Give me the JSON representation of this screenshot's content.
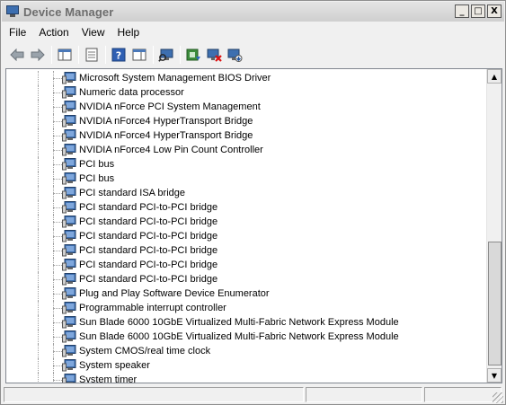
{
  "window": {
    "title": "Device Manager",
    "caption": {
      "minimize": "_",
      "maximize": "□",
      "close": "X"
    }
  },
  "menu": [
    "File",
    "Action",
    "View",
    "Help"
  ],
  "toolbar": {
    "buttons": [
      "back-arrow-icon",
      "forward-arrow-icon",
      "show-hide-console-tree-icon",
      "properties-icon",
      "help-icon",
      "action-pane-icon",
      "scan-hardware-icon",
      "update-driver-icon",
      "uninstall-icon",
      "disable-device-icon"
    ]
  },
  "tree": {
    "items": [
      "Microsoft System Management BIOS Driver",
      "Numeric data processor",
      "NVIDIA nForce PCI System Management",
      "NVIDIA nForce4 HyperTransport Bridge",
      "NVIDIA nForce4 HyperTransport Bridge",
      "NVIDIA nForce4 Low Pin Count Controller",
      "PCI bus",
      "PCI bus",
      "PCI standard ISA bridge",
      "PCI standard PCI-to-PCI bridge",
      "PCI standard PCI-to-PCI bridge",
      "PCI standard PCI-to-PCI bridge",
      "PCI standard PCI-to-PCI bridge",
      "PCI standard PCI-to-PCI bridge",
      "PCI standard PCI-to-PCI bridge",
      "Plug and Play Software Device Enumerator",
      "Programmable interrupt controller",
      "Sun Blade 6000 10GbE Virtualized Multi-Fabric Network Express Module",
      "Sun Blade 6000 10GbE Virtualized Multi-Fabric Network Express Module",
      "System CMOS/real time clock",
      "System speaker",
      "System timer"
    ]
  },
  "scrollbar": {
    "up_arrow": "▲",
    "down_arrow": "▼"
  },
  "colors": {
    "title_text": "#6d6d6d",
    "device_icon": "#3d6fb0"
  }
}
